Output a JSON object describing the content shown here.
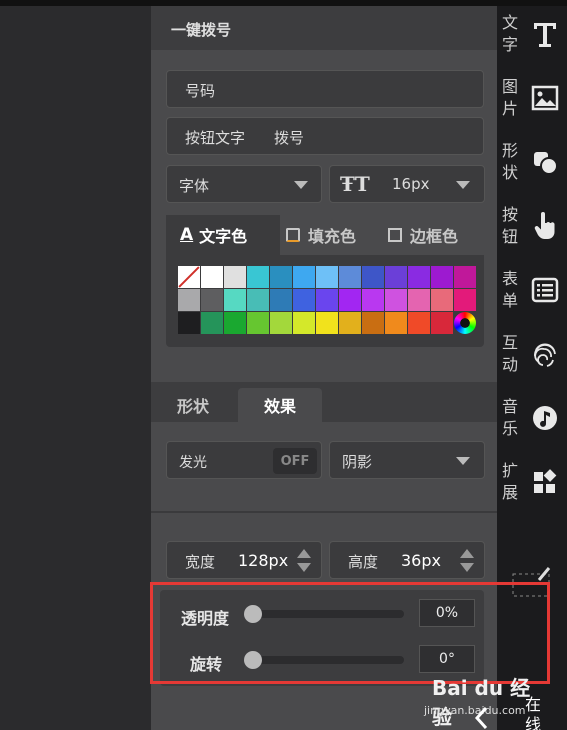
{
  "panel": {
    "title": "一键拨号",
    "number_field_label": "号码",
    "button_text_label": "按钮文字",
    "button_text_value": "拨号",
    "font_label": "字体",
    "font_size_value": "16px"
  },
  "color_tabs": {
    "text_color": "文字色",
    "fill_color": "填充色",
    "border_color": "边框色"
  },
  "swatches": {
    "row1": [
      "none",
      "#ffffff",
      "#e0e0e0",
      "#39c6d3",
      "#2a8fbf",
      "#3ea8f0",
      "#6ec0f7",
      "#5d8bd9",
      "#3e56c8",
      "#6b3fd8",
      "#8a2be2",
      "#9d1ad0",
      "#c0189a"
    ],
    "row2": [
      "#a9a9ab",
      "#5e5e60",
      "#56d9c2",
      "#48bdb6",
      "#2e7bb6",
      "#3f62e0",
      "#6a45ee",
      "#a226f2",
      "#b938f0",
      "#cf52e0",
      "#e464b0",
      "#e86a7a",
      "#e31a7a"
    ],
    "row3": [
      "#1e1e20",
      "#25945a",
      "#1aa830",
      "#66c630",
      "#a3d83b",
      "#d4e82a",
      "#f1e21c",
      "#e2b01c",
      "#c96e12",
      "#f08a1c",
      "#f04a28",
      "#d8283a",
      "wheel"
    ]
  },
  "mode_tabs": {
    "shape": "形状",
    "effect": "效果"
  },
  "effects": {
    "glow_label": "发光",
    "glow_toggle": "OFF",
    "shadow_label": "阴影"
  },
  "size": {
    "width_label": "宽度",
    "width_value": "128px",
    "height_label": "高度",
    "height_value": "36px"
  },
  "sliders": {
    "opacity_label": "透明度",
    "opacity_value": "0%",
    "rotate_label": "旋转",
    "rotate_value": "0°"
  },
  "sidebar": {
    "items": [
      {
        "label": "文字",
        "icon": "text-icon"
      },
      {
        "label": "图片",
        "icon": "image-icon"
      },
      {
        "label": "形状",
        "icon": "shape-icon"
      },
      {
        "label": "按钮",
        "icon": "hand-pointer-icon"
      },
      {
        "label": "表单",
        "icon": "list-icon"
      },
      {
        "label": "互动",
        "icon": "fingerprint-icon"
      },
      {
        "label": "音乐",
        "icon": "music-icon"
      },
      {
        "label": "扩展",
        "icon": "apps-icon"
      }
    ]
  },
  "watermark": {
    "brand": "Bai du 经验",
    "url": "jingyan.baidu.com",
    "side_text": "在线"
  },
  "colors": {
    "highlight_border": "#e53935",
    "panel_bg": "#4a4a4c",
    "sidebar_bg": "#1b1b1d"
  }
}
